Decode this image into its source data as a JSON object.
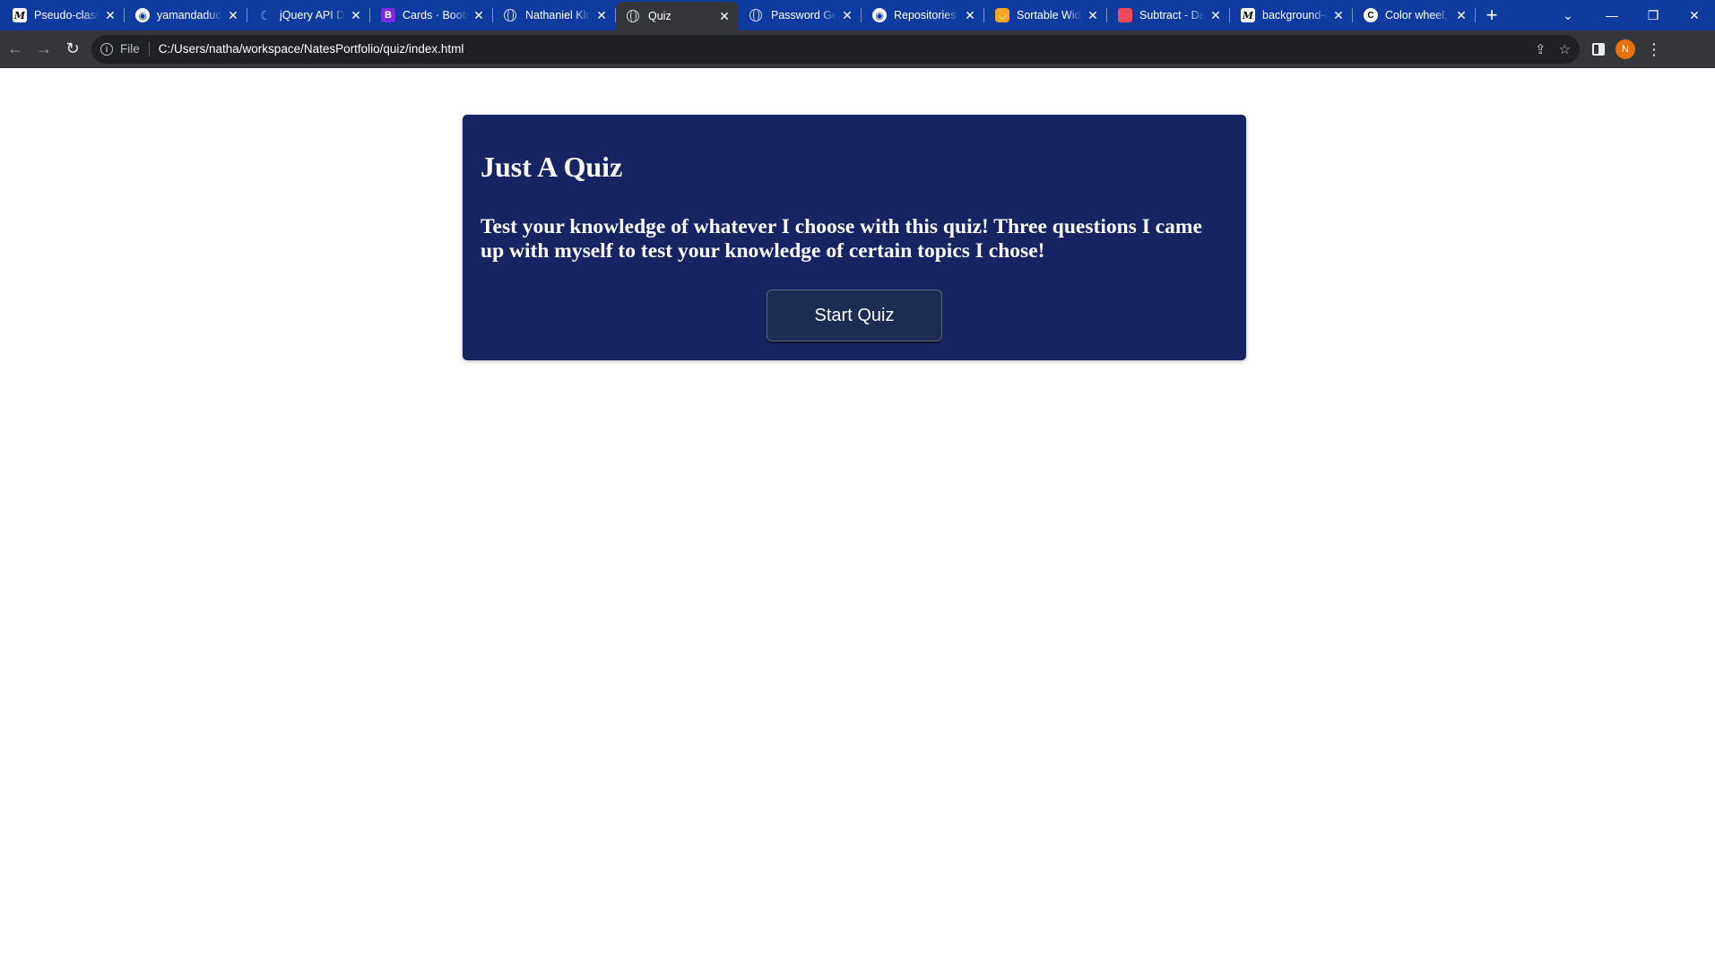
{
  "browser": {
    "tabs": [
      {
        "title": "Pseudo-classes",
        "icon": "mdn-icon",
        "active": false
      },
      {
        "title": "yamandaduck",
        "icon": "github-icon",
        "active": false
      },
      {
        "title": "jQuery API Documentation",
        "icon": "jquery-icon",
        "active": false
      },
      {
        "title": "Cards · Bootstrap",
        "icon": "bootstrap-icon",
        "active": false
      },
      {
        "title": "Nathaniel Klotz",
        "icon": "globe-icon",
        "active": false
      },
      {
        "title": "Quiz",
        "icon": "globe-icon",
        "active": true
      },
      {
        "title": "Password Generator",
        "icon": "globe-icon",
        "active": false
      },
      {
        "title": "Repositories",
        "icon": "github-icon",
        "active": false
      },
      {
        "title": "Sortable Widget",
        "icon": "jquery-ui-icon",
        "active": false
      },
      {
        "title": "Subtract - Day.js",
        "icon": "dayjs-icon",
        "active": false
      },
      {
        "title": "background-color",
        "icon": "mdn-icon",
        "active": false
      },
      {
        "title": "Color wheel, a color palette",
        "icon": "color-wheel-icon",
        "active": false
      }
    ],
    "address": {
      "scheme_chip": "File",
      "url": "C:/Users/natha/workspace/NatesPortfolio/quiz/index.html"
    },
    "profile_initial": "N",
    "colors": {
      "tabstrip": "#0f3ba0",
      "toolbar": "#35363a",
      "omnibox": "#202124",
      "avatar": "#e8710a"
    }
  },
  "page": {
    "title": "Just A Quiz",
    "description": "Test your knowledge of whatever I choose with this quiz! Three questions I came up with myself to test your knowledge of certain topics I chose!",
    "start_button": "Start Quiz",
    "colors": {
      "card": "#172463",
      "button": "#1c2c53",
      "text": "#ffffff"
    }
  }
}
